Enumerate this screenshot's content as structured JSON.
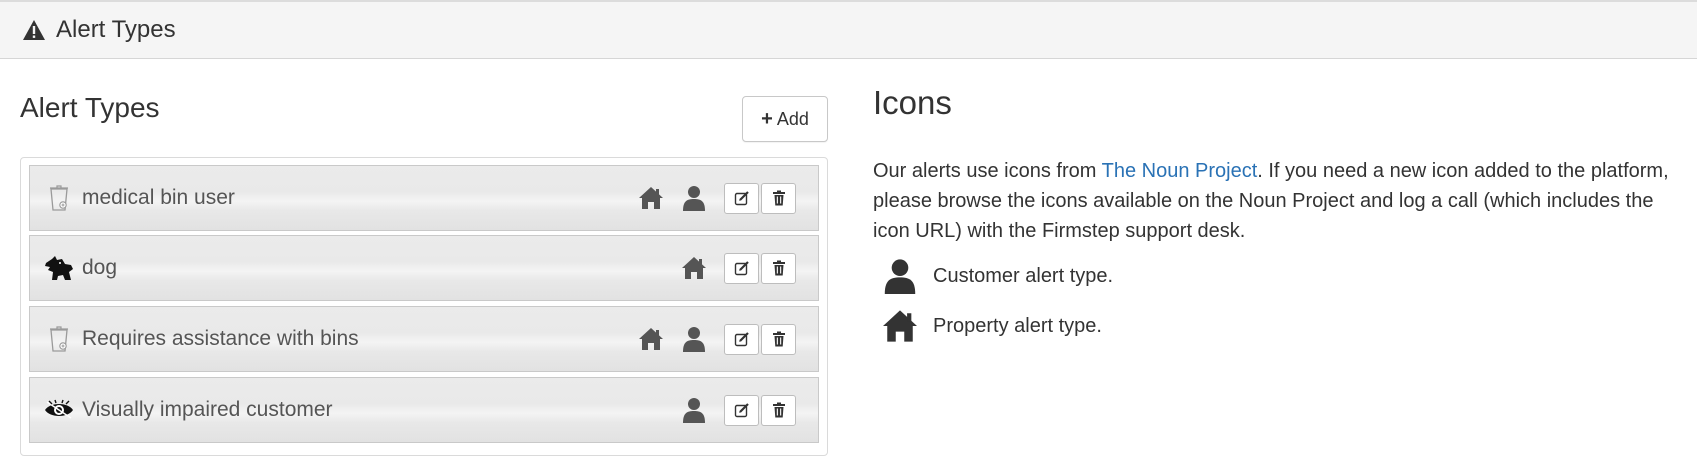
{
  "header": {
    "title": "Alert Types",
    "icon": "warning-icon"
  },
  "left": {
    "heading": "Alert Types",
    "add_label": "Add",
    "items": [
      {
        "label": "medical bin user",
        "icon": "bin-icon",
        "property": true,
        "customer": true
      },
      {
        "label": "dog",
        "icon": "dog-icon",
        "property": true,
        "customer": false
      },
      {
        "label": "Requires assistance with bins",
        "icon": "bin-icon",
        "property": true,
        "customer": true
      },
      {
        "label": "Visually impaired customer",
        "icon": "eye-icon",
        "property": false,
        "customer": true
      }
    ]
  },
  "right": {
    "heading": "Icons",
    "para_before": "Our alerts use icons from ",
    "link_text": "The Noun Project",
    "para_after": ". If you need a new icon added to the platform, please browse the icons available on the Noun Project and log a call (which includes the icon URL) with the Firmstep support desk.",
    "legend": [
      {
        "icon": "user-icon",
        "text": "Customer alert type."
      },
      {
        "icon": "home-icon",
        "text": "Property alert type."
      }
    ]
  }
}
